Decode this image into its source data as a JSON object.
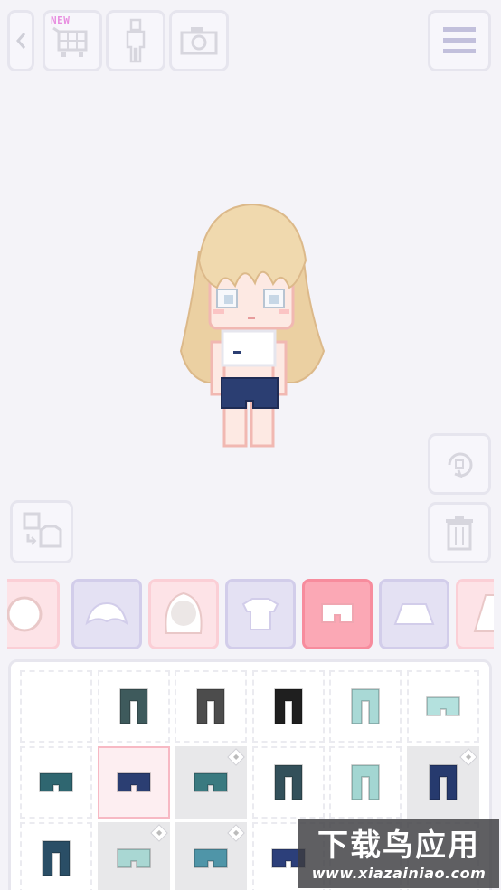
{
  "toolbar": {
    "back_icon": "chevron-left-icon",
    "shop_icon": "cart-icon",
    "shop_badge": "NEW",
    "body_icon": "body-silhouette-icon",
    "camera_icon": "camera-icon",
    "menu_icon": "hamburger-menu-icon"
  },
  "side_controls": {
    "rotate_icon": "rotate-icon",
    "trash_icon": "trash-icon",
    "swap_icon": "swap-outfit-icon"
  },
  "categories": [
    {
      "icon": "face-category-icon",
      "state": "partial"
    },
    {
      "icon": "bangs-category-icon",
      "state": "normal"
    },
    {
      "icon": "hair-category-icon",
      "state": "normal"
    },
    {
      "icon": "top-category-icon",
      "state": "normal"
    },
    {
      "icon": "bottoms-category-icon",
      "state": "selected"
    },
    {
      "icon": "skirt-category-icon",
      "state": "normal"
    },
    {
      "icon": "dress-category-icon",
      "state": "partial"
    }
  ],
  "items": [
    {
      "kind": "empty",
      "color": "",
      "locked": false
    },
    {
      "kind": "long",
      "color": "#3e5a5c",
      "locked": false
    },
    {
      "kind": "long",
      "color": "#4c4c4c",
      "locked": false
    },
    {
      "kind": "long",
      "color": "#1f1f1f",
      "locked": false
    },
    {
      "kind": "long",
      "color": "#a9d9d6",
      "locked": false
    },
    {
      "kind": "short",
      "color": "#b4e1de",
      "locked": false
    },
    {
      "kind": "short",
      "color": "#2f6670",
      "locked": false
    },
    {
      "kind": "short",
      "color": "#2b3e72",
      "locked": false,
      "selected": true
    },
    {
      "kind": "short",
      "color": "#3a7a80",
      "locked": true
    },
    {
      "kind": "long",
      "color": "#33505a",
      "locked": false
    },
    {
      "kind": "long",
      "color": "#a3d6d2",
      "locked": false
    },
    {
      "kind": "long",
      "color": "#263a6e",
      "locked": true
    },
    {
      "kind": "long",
      "color": "#2a4e66",
      "locked": false
    },
    {
      "kind": "short",
      "color": "#a9d7d3",
      "locked": true
    },
    {
      "kind": "short",
      "color": "#4f95a8",
      "locked": true
    },
    {
      "kind": "short",
      "color": "#2c3f7a",
      "locked": false
    },
    {
      "kind": "empty",
      "color": "",
      "locked": false
    },
    {
      "kind": "empty",
      "color": "",
      "locked": false
    }
  ],
  "watermark": {
    "title": "下载鸟应用",
    "url": "www.xiazainiao.com"
  },
  "colors": {
    "background": "#f4f3f8",
    "category_pink": "#fde3e7",
    "category_lavender": "#e4e1f3",
    "category_selected": "#fba8b5",
    "hair": "#ebd0a2",
    "skin": "#fde9e3",
    "shorts": "#2b3e72"
  }
}
